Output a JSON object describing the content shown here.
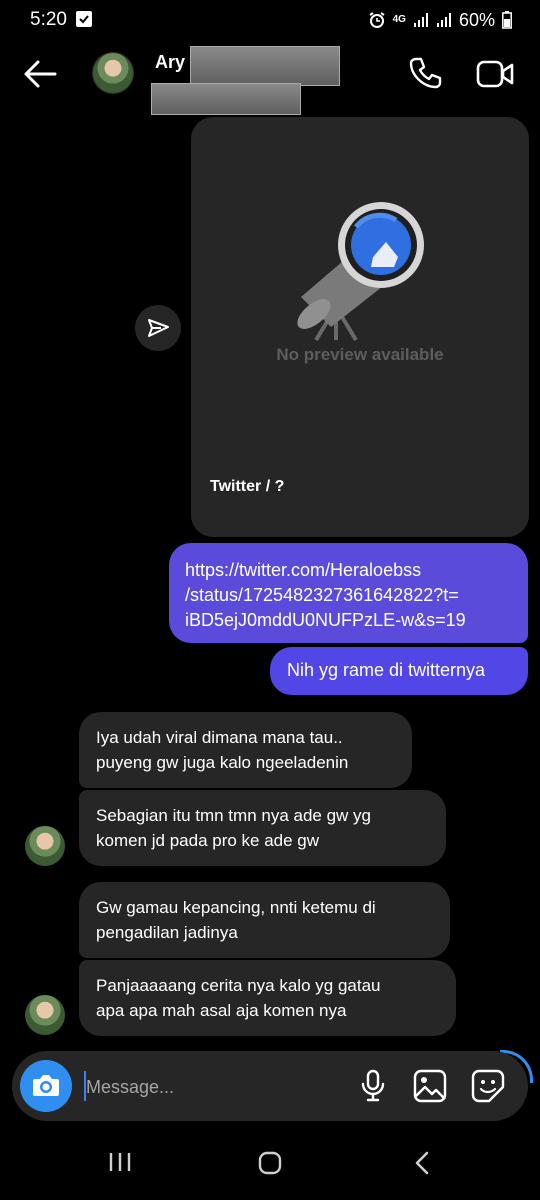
{
  "status_bar": {
    "time": "5:20",
    "network": "4G",
    "battery": "60%"
  },
  "header": {
    "contact_name": "Ary"
  },
  "link_preview": {
    "no_preview_text": "No preview available",
    "source_label": "Twitter / ?"
  },
  "messages": {
    "sent": [
      "https://twitter.com/Heraloebss /status/1725482327361642822?t= iBD5ejJ0mddU0NUFPzLE-w&s=19",
      "Nih yg rame di twitternya"
    ],
    "received": [
      {
        "line1": "Iya udah viral dimana mana tau..",
        "line2": "puyeng gw juga kalo ngeeladenin"
      },
      {
        "line1": "Sebagian itu tmn tmn nya ade gw yg",
        "line2": "komen jd pada pro ke ade gw"
      },
      {
        "line1": "Gw gamau kepancing, nnti ketemu di",
        "line2": "pengadilan jadinya"
      },
      {
        "line1": "Panjaaaaang cerita nya kalo yg gatau",
        "line2": "apa apa mah asal aja komen nya"
      }
    ]
  },
  "composer": {
    "placeholder": "Message..."
  },
  "colors": {
    "background": "#000000",
    "sent_bubble": "#5b4bdb",
    "received_bubble": "#262626",
    "accent_blue": "#2f8ef0"
  }
}
